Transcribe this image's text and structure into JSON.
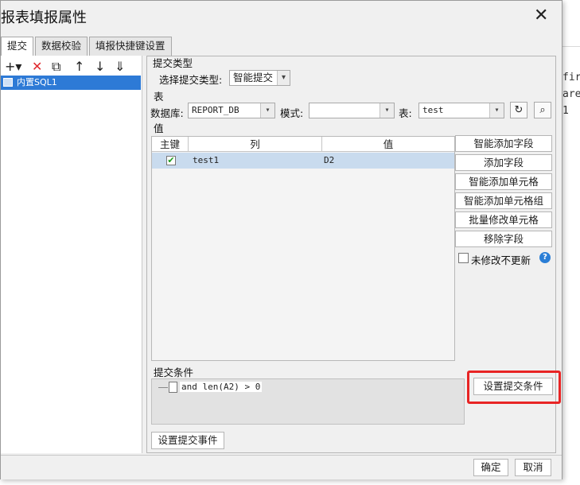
{
  "background": {
    "code_lines": [
      "fir",
      "are",
      "1"
    ]
  },
  "dialog": {
    "title": "报表填报属性",
    "close_label": "✕"
  },
  "tabs": [
    {
      "label": "提交",
      "active": true
    },
    {
      "label": "数据校验",
      "active": false
    },
    {
      "label": "填报快捷键设置",
      "active": false
    }
  ],
  "left": {
    "toolbar": [
      "+▾",
      "✕",
      "⧉",
      "↑",
      "↓",
      "⇓"
    ],
    "tree_item": "内置SQL1"
  },
  "submit_type": {
    "section_label": "提交类型",
    "select_label": "选择提交类型:",
    "value": "智能提交"
  },
  "table_section": {
    "section_label": "表",
    "db_label": "数据库:",
    "db_value": "REPORT_DB",
    "mode_label": "模式:",
    "mode_value": "",
    "table_label": "表:",
    "table_value": "test"
  },
  "value_section": {
    "section_label": "值",
    "columns": [
      "主键",
      "列",
      "值"
    ],
    "rows": [
      {
        "key_checked": true,
        "column": "test1",
        "value": "D2"
      }
    ]
  },
  "side_buttons": [
    "智能添加字段",
    "添加字段",
    "智能添加单元格",
    "智能添加单元格组",
    "批量修改单元格",
    "移除字段"
  ],
  "no_update_label": "未修改不更新",
  "help_icon": "?",
  "condition": {
    "section_label": "提交条件",
    "text": "and len(A2) > 0",
    "set_button": "设置提交条件"
  },
  "event_button": "设置提交事件",
  "footer": {
    "ok": "确定",
    "cancel": "取消"
  },
  "colors": {
    "selection": "#2d7ad6",
    "row_highlight": "#c9dbee",
    "annotation_red": "#e82424"
  }
}
